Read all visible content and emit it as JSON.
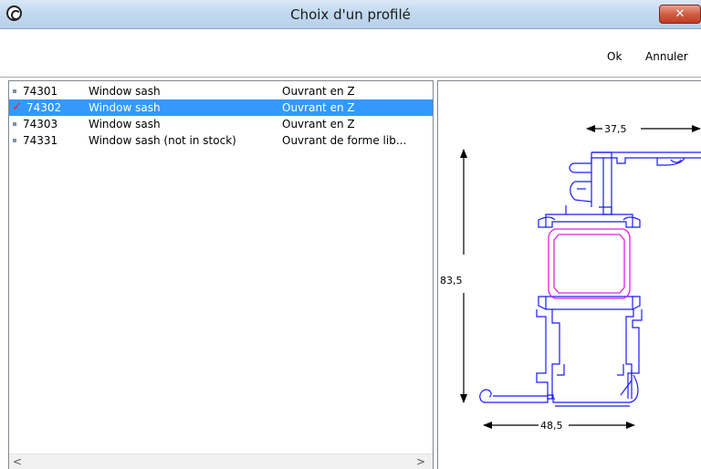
{
  "window": {
    "title": "Choix d'un  profilé",
    "close_label": "✕"
  },
  "toolbar": {
    "ok_label": "Ok",
    "cancel_label": "Annuler"
  },
  "profiles": [
    {
      "code": "74301",
      "name": "Window sash",
      "description": "Ouvrant en Z",
      "selected": false
    },
    {
      "code": "74302",
      "name": "Window sash",
      "description": "Ouvrant en Z",
      "selected": true
    },
    {
      "code": "74303",
      "name": "Window sash",
      "description": "Ouvrant en Z",
      "selected": false
    },
    {
      "code": "74331",
      "name": "Window sash (not in stock)",
      "description": "Ouvrant de forme lib...",
      "selected": false
    }
  ],
  "scrollbar": {
    "left_arrow": "<",
    "right_arrow": ">"
  },
  "preview": {
    "dim_top": "37,5",
    "dim_left": "83,5",
    "dim_bottom": "48,5"
  },
  "colors": {
    "selection": "#3399ff",
    "profile_outline": "#1a1aff",
    "gasket": "#e020e0",
    "check": "#e22222"
  }
}
